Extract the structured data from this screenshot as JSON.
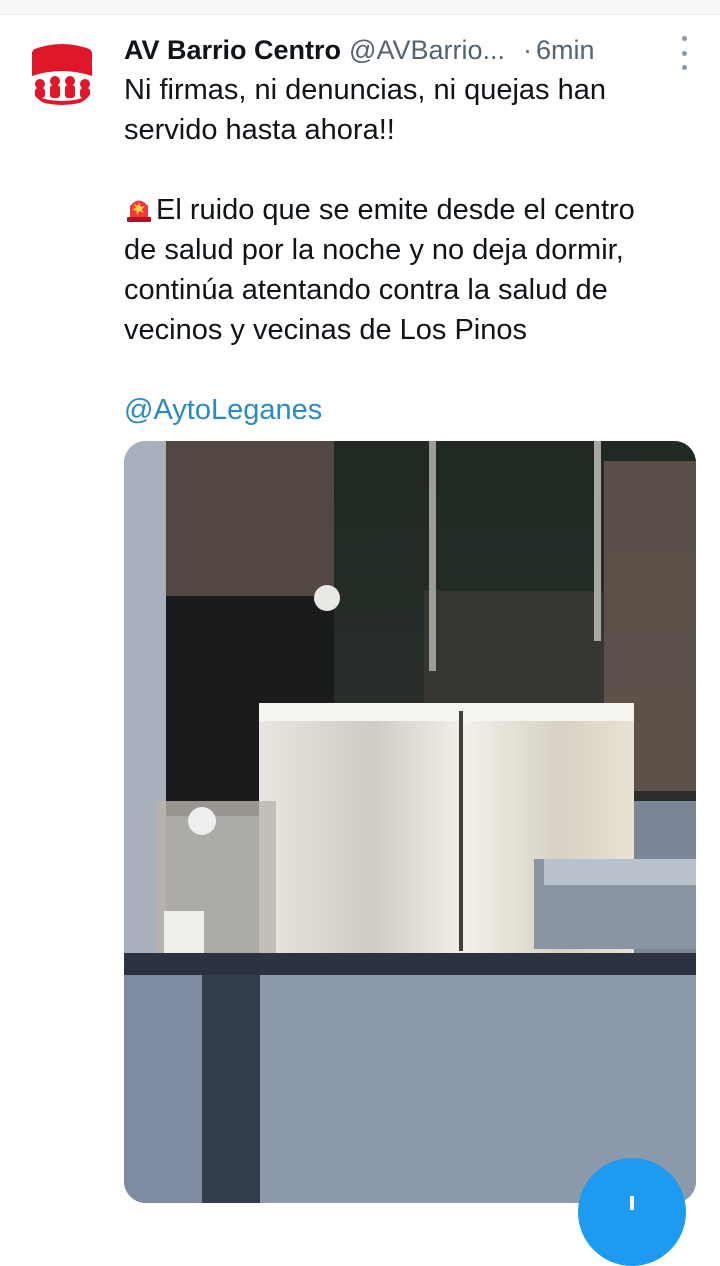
{
  "tweet": {
    "display_name": "AV Barrio Centro",
    "handle": "@AVBarrio...",
    "separator": "·",
    "time": "6min",
    "line1": "Ni firmas, ni denuncias, ni quejas han",
    "line2": "servido hasta ahora!!",
    "line3": "El ruido que se emite desde el centro",
    "line4": "de salud  por la noche y no deja dormir,",
    "line5": "continúa atentando contra la salud de",
    "line6": "vecinos y vecinas de Los Pinos",
    "mention": "@AytoLeganes"
  },
  "icons": {
    "avatar": "red-neighbourhood-logo",
    "siren": "police-light-emoji",
    "more": "vertical-ellipsis-icon",
    "compose": "compose-plus-icon"
  },
  "colors": {
    "link": "#2a8bc4",
    "secondary_text": "#536471",
    "brand_red": "#e0162b",
    "fab_blue": "#1d9bf0"
  }
}
